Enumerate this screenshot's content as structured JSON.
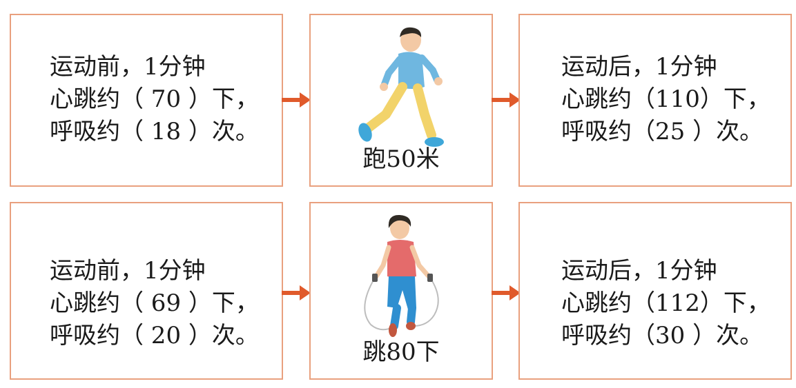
{
  "colors": {
    "border": "#e9a07e",
    "arrow": "#e05a2b"
  },
  "rows": [
    {
      "before": {
        "line1": "运动前，1分钟",
        "line2": "心跳约（ 70 ）下，",
        "line3": "呼吸约（ 18 ）次。"
      },
      "activity": {
        "label": "跑50米",
        "icon": "running-child"
      },
      "after": {
        "line1": "运动后，1分钟",
        "line2": "心跳约（110）下，",
        "line3": "呼吸约（25 ）次。"
      }
    },
    {
      "before": {
        "line1": "运动前，1分钟",
        "line2": "心跳约（ 69 ）下，",
        "line3": "呼吸约（ 20 ）次。"
      },
      "activity": {
        "label": "跳80下",
        "icon": "jump-rope-child"
      },
      "after": {
        "line1": "运动后，1分钟",
        "line2": "心跳约（112）下，",
        "line3": "呼吸约（30 ）次。"
      }
    }
  ]
}
